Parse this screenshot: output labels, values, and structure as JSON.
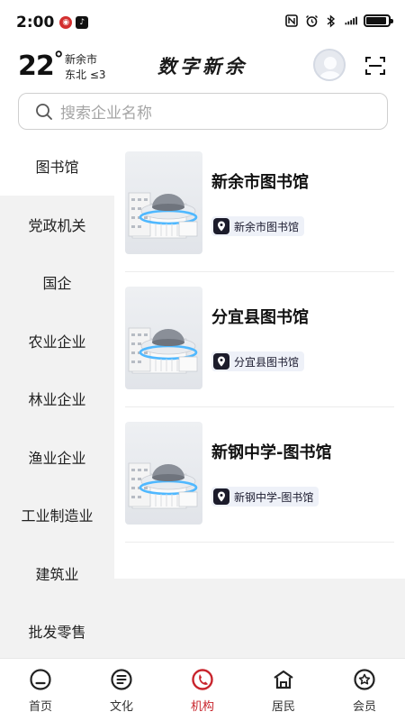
{
  "status": {
    "time": "2:00",
    "battery_level": 0.9
  },
  "header": {
    "temperature": "22",
    "degree": "°",
    "city": "新余市",
    "wind": "东北 ≤3",
    "brand": "数字新余"
  },
  "search": {
    "placeholder": "搜索企业名称"
  },
  "sidebar": {
    "items": [
      {
        "label": "图书馆",
        "active": true
      },
      {
        "label": "党政机关"
      },
      {
        "label": "国企"
      },
      {
        "label": "农业企业"
      },
      {
        "label": "林业企业"
      },
      {
        "label": "渔业企业"
      },
      {
        "label": "工业制造业"
      },
      {
        "label": "建筑业"
      },
      {
        "label": "批发零售"
      }
    ]
  },
  "cards": [
    {
      "title": "新余市图书馆",
      "tag": "新余市图书馆"
    },
    {
      "title": "分宜县图书馆",
      "tag": "分宜县图书馆"
    },
    {
      "title": "新钢中学-图书馆",
      "tag": "新钢中学-图书馆"
    }
  ],
  "bottom_nav": [
    {
      "label": "首页",
      "icon": "home-icon"
    },
    {
      "label": "文化",
      "icon": "culture-icon"
    },
    {
      "label": "机构",
      "icon": "institution-icon",
      "active": true
    },
    {
      "label": "居民",
      "icon": "resident-icon"
    },
    {
      "label": "会员",
      "icon": "member-icon"
    }
  ],
  "colors": {
    "accent": "#c8242c",
    "sidebar_bg": "#f2f2f2",
    "tag_bg": "#eef1f8",
    "library_glow": "#4fb8ff"
  }
}
